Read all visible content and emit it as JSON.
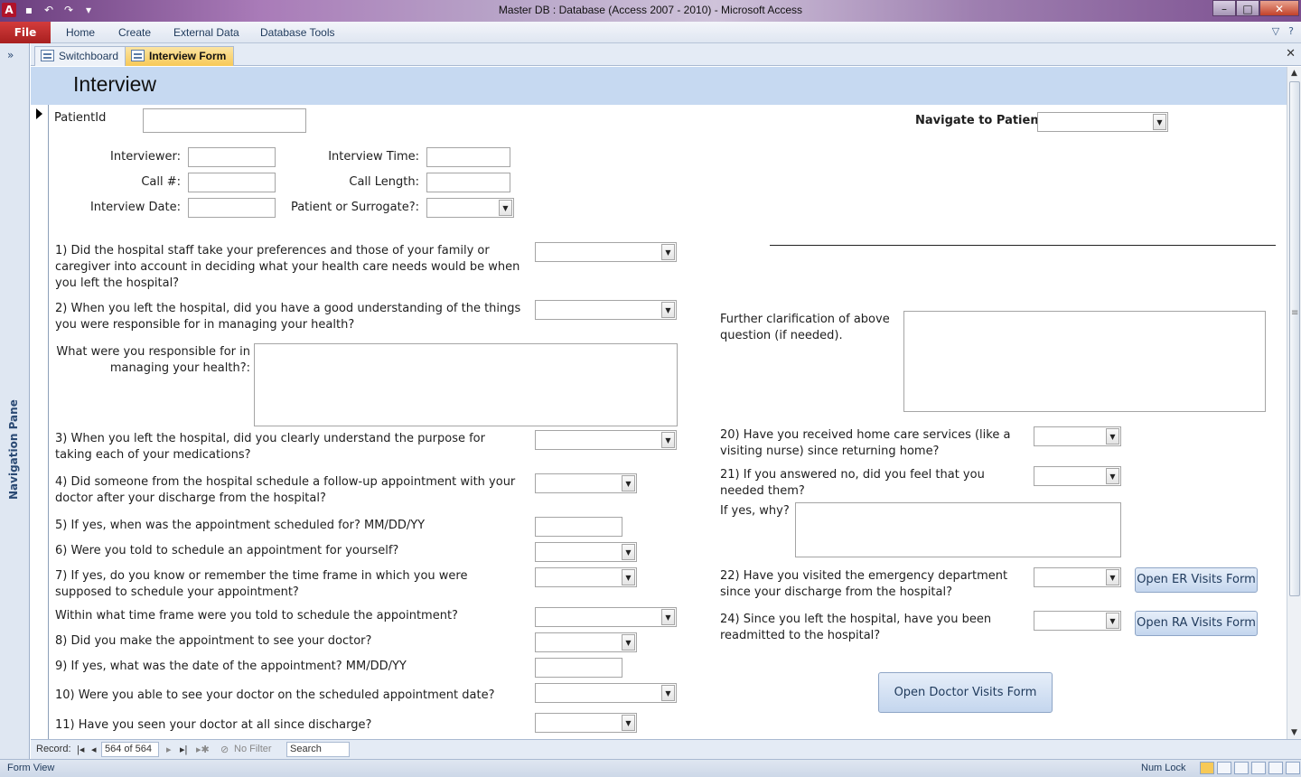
{
  "window": {
    "title": "Master DB : Database (Access 2007 - 2010)  -  Microsoft Access",
    "app_icon": "A"
  },
  "ribbon": {
    "file": "File",
    "tabs": [
      "Home",
      "Create",
      "External Data",
      "Database Tools"
    ]
  },
  "nav_pane": {
    "label": "Navigation Pane",
    "toggle": "»"
  },
  "doc_tabs": [
    {
      "label": "Switchboard",
      "active": false
    },
    {
      "label": "Interview Form",
      "active": true
    }
  ],
  "form": {
    "title": "Interview",
    "patient_id_label": "PatientId",
    "navigate_label": "Navigate to Patient:",
    "interviewer_label": "Interviewer:",
    "call_num_label": "Call #:",
    "interview_date_label": "Interview Date:",
    "interview_time_label": "Interview Time:",
    "call_length_label": "Call Length:",
    "patient_surrogate_label": "Patient or Surrogate?:",
    "q1": "1) Did the hospital staff take your preferences and those of your family or caregiver into account in deciding what your health care needs would be when you left the hospital?",
    "q2": "2) When you left the hospital, did you have a good understanding of the things you were responsible for in managing your health?",
    "q2_detail": "What were you responsible for in managing your health?:",
    "q3": "3) When you left the hospital, did you clearly understand the purpose for taking each of your medications?",
    "q4": "4) Did someone from the hospital schedule a follow-up appointment with your doctor after your discharge from the hospital?",
    "q5": "5) If yes, when was the appointment scheduled for? MM/DD/YY",
    "q6": "6) Were you told to schedule an appointment for yourself?",
    "q7": "7) If yes, do you know or remember the time frame in which you were supposed to schedule your appointment?",
    "q7_detail": "Within what time frame were you told to schedule the appointment?",
    "q8": "8) Did you make the appointment to see your doctor?",
    "q9": "9) If yes, what was the date of the appointment? MM/DD/YY",
    "q10": "10) Were you able to see your doctor on the scheduled appointment date?",
    "q11": "11) Have you seen your doctor at all since discharge?",
    "further_clarification": "Further clarification of above question (if needed).",
    "q20": "20) Have you received home care services (like a visiting nurse) since returning home?",
    "q21": "21) If you answered no, did you feel that you needed them?",
    "q21_why": "If yes, why?",
    "q22": "22) Have you visited the emergency department since your discharge from the hospital?",
    "q24": "24) Since you left the hospital, have you been readmitted to the hospital?",
    "btn_er": "Open ER Visits Form",
    "btn_ra": "Open RA Visits Form",
    "btn_doctor": "Open Doctor Visits Form"
  },
  "record_nav": {
    "label": "Record:",
    "position": "564 of 564",
    "filter": "No Filter",
    "search": "Search"
  },
  "status": {
    "view": "Form View",
    "numlock": "Num Lock"
  },
  "colors": {
    "form_header": "#c6d9f1",
    "file_tab": "#b22a2a",
    "active_tab": "#f7c957"
  }
}
